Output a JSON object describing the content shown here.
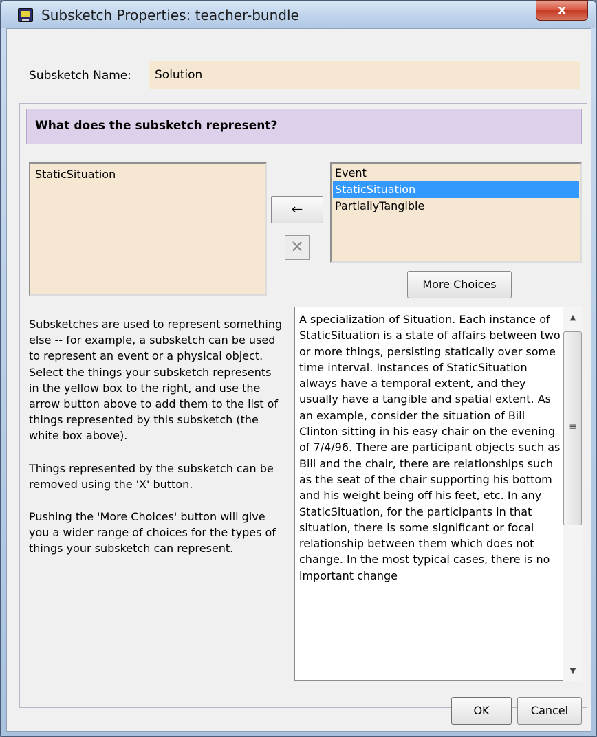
{
  "window": {
    "title": "Subsketch Properties: teacher-bundle",
    "close_label": "x"
  },
  "name_field": {
    "label": "Subsketch Name:",
    "value": "Solution"
  },
  "section": {
    "header": "What does the subsketch represent?"
  },
  "represented_list": {
    "items": [
      "StaticSituation"
    ]
  },
  "buttons": {
    "add_label": "←",
    "remove_label": "✕",
    "more_choices": "More Choices",
    "ok": "OK",
    "cancel": "Cancel"
  },
  "choices_list": {
    "items": [
      "Event",
      "StaticSituation",
      "PartiallyTangible"
    ],
    "selected": "StaticSituation"
  },
  "help": {
    "paragraph1": "Subsketches are used to represent something else -- for example, a subsketch can be used to represent an event or a physical object. Select the things your subsketch represents in the yellow box to the right, and use the arrow button above to add them to the list of things represented by this subsketch (the white box above).",
    "paragraph2": "Things represented by the subsketch can be removed using the 'X' button.",
    "paragraph3": "Pushing the 'More Choices' button will give you a wider range of choices for the types of things your subsketch can represent."
  },
  "description": {
    "text": "A specialization of Situation. Each instance of StaticSituation is a state of affairs between two or more things, persisting statically over some time interval. Instances of StaticSituation always have a temporal extent, and they usually have a tangible and spatial extent. As an example, consider the situation of Bill Clinton sitting in his easy chair on the evening of 7/4/96. There are participant objects such as Bill and the chair, there are relationships such as the seat of the chair supporting his bottom and his weight being off his feet, etc. In any StaticSituation, for the participants in that situation, there is some significant or focal relationship between them which does not change. In the most typical cases, there is no important change"
  },
  "colors": {
    "field_bg": "#f5e7d1",
    "header_bg": "#dcd0ea",
    "selection": "#3399ff",
    "close_button": "#d7553f"
  },
  "icons": {
    "title": "application-icon",
    "scroll_up": "scroll-up-arrow-icon",
    "scroll_down": "scroll-down-arrow-icon"
  }
}
